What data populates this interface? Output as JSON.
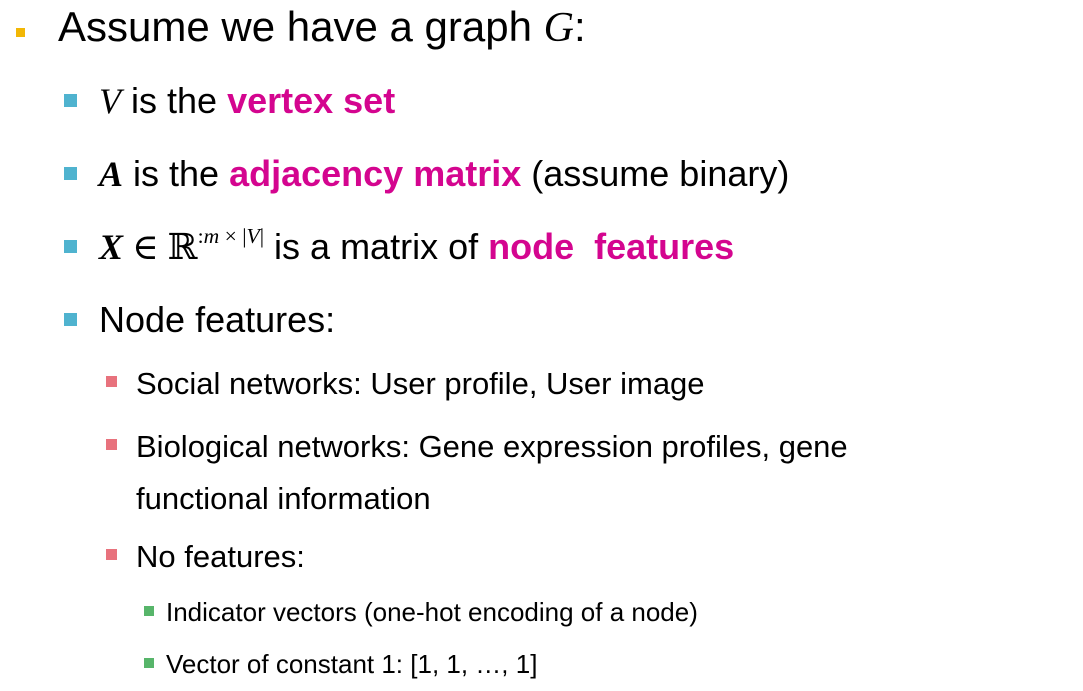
{
  "colors": {
    "bullet_level1": "#f2b705",
    "bullet_level2": "#4fb3cf",
    "bullet_level3": "#e8727d",
    "bullet_level4": "#57b56a",
    "highlight": "#d4058f",
    "text": "#000000"
  },
  "lines": {
    "l1": {
      "prefix": "Assume we have a graph ",
      "var": "G",
      "suffix": ":"
    },
    "vertex": {
      "var": "V",
      "mid": " is the ",
      "highlight": "vertex set"
    },
    "adjacency": {
      "var": "A",
      "mid": " is the ",
      "highlight": "adjacency matrix",
      "suffix": " (assume binary)"
    },
    "features": {
      "var": "X",
      "elem": " ∈ ",
      "reals": "ℝ",
      "sup_colon": ":",
      "sup_m": "m",
      "sup_times": " × ",
      "sup_bar_left": "|",
      "sup_v": "V",
      "sup_bar_right": "|",
      "mid": " is a matrix of ",
      "highlight": "node  features"
    },
    "node_features": "Node features:",
    "social": "Social networks: User profile, User image",
    "bio_line1": "Biological networks: Gene expression profiles, gene",
    "bio_line2": "functional information",
    "no_features": "No features:",
    "indicator": "Indicator vectors (one-hot encoding of a node)",
    "constant": "Vector of constant 1: [1, 1, …, 1]"
  }
}
